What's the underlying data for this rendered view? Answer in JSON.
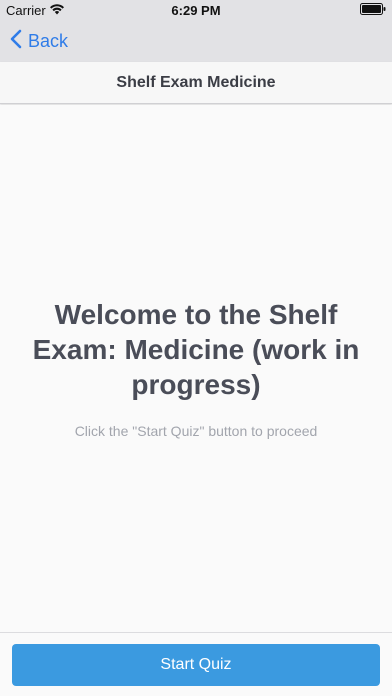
{
  "status_bar": {
    "carrier": "Carrier",
    "time": "6:29 PM",
    "icons": [
      "wifi-icon",
      "battery-icon"
    ]
  },
  "nav": {
    "back_label": "Back",
    "back_icon": "chevron-left-icon"
  },
  "header": {
    "title": "Shelf Exam Medicine"
  },
  "main": {
    "welcome": "Welcome to the Shelf Exam: Medicine (work in progress)",
    "instruction": "Click the \"Start Quiz\" button to proceed"
  },
  "footer": {
    "start_label": "Start Quiz"
  },
  "colors": {
    "accent": "#2f7ce8",
    "button": "#3b9ae0",
    "heading": "#4a4d58",
    "muted": "#a2a5ad"
  }
}
